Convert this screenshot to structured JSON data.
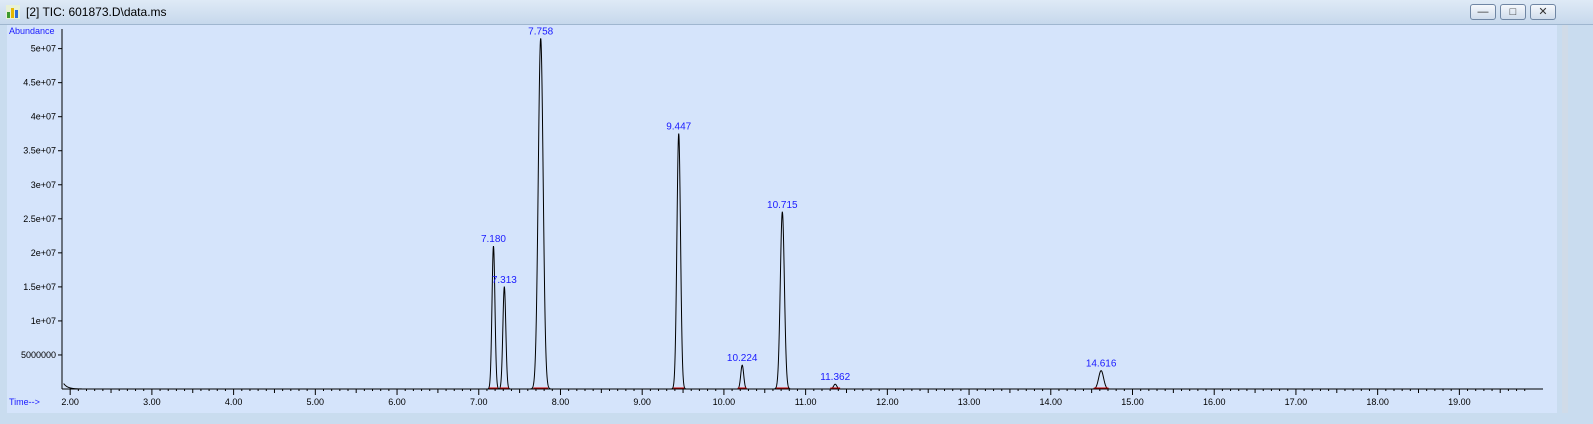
{
  "window": {
    "title": "[2] TIC: 601873.D\\data.ms",
    "controls": [
      "minimize",
      "maximize",
      "close"
    ],
    "icon": "chromatogram-app-icon"
  },
  "chart_data": {
    "type": "line",
    "ylabel": "Abundance",
    "xlabel": "Time-->",
    "xlim": [
      1.9,
      19.95
    ],
    "ylim": [
      0,
      52000000
    ],
    "x_ticks": [
      2.0,
      3.0,
      4.0,
      5.0,
      6.0,
      7.0,
      8.0,
      9.0,
      10.0,
      11.0,
      12.0,
      13.0,
      14.0,
      15.0,
      16.0,
      17.0,
      18.0,
      19.0
    ],
    "x_tick_labels": [
      "2.00",
      "3.00",
      "4.00",
      "5.00",
      "6.00",
      "7.00",
      "8.00",
      "9.00",
      "10.00",
      "11.00",
      "12.00",
      "13.00",
      "14.00",
      "15.00",
      "16.00",
      "17.00",
      "18.00",
      "19.00"
    ],
    "y_ticks": [
      5000000,
      10000000,
      15000000,
      20000000,
      25000000,
      30000000,
      35000000,
      40000000,
      45000000,
      50000000
    ],
    "y_tick_labels": [
      "5000000",
      "1e+07",
      "1.5e+07",
      "2e+07",
      "2.5e+07",
      "3e+07",
      "3.5e+07",
      "4e+07",
      "4.5e+07",
      "5e+07"
    ],
    "peaks": [
      {
        "rt": 7.18,
        "label": "7.180",
        "height": 21000000,
        "width": 0.018
      },
      {
        "rt": 7.313,
        "label": "7.313",
        "height": 15000000,
        "width": 0.018
      },
      {
        "rt": 7.758,
        "label": "7.758",
        "height": 51500000,
        "width": 0.03
      },
      {
        "rt": 9.447,
        "label": "9.447",
        "height": 37500000,
        "width": 0.022
      },
      {
        "rt": 10.224,
        "label": "10.224",
        "height": 3500000,
        "width": 0.018
      },
      {
        "rt": 10.715,
        "label": "10.715",
        "height": 26000000,
        "width": 0.025
      },
      {
        "rt": 11.362,
        "label": "11.362",
        "height": 700000,
        "width": 0.02
      },
      {
        "rt": 14.616,
        "label": "14.616",
        "height": 2700000,
        "width": 0.03
      }
    ],
    "colors": {
      "background": "#d5e4fb",
      "trace": "#000000",
      "labels": "#1a1aff",
      "integration": "#cc0000"
    },
    "grid": false
  }
}
